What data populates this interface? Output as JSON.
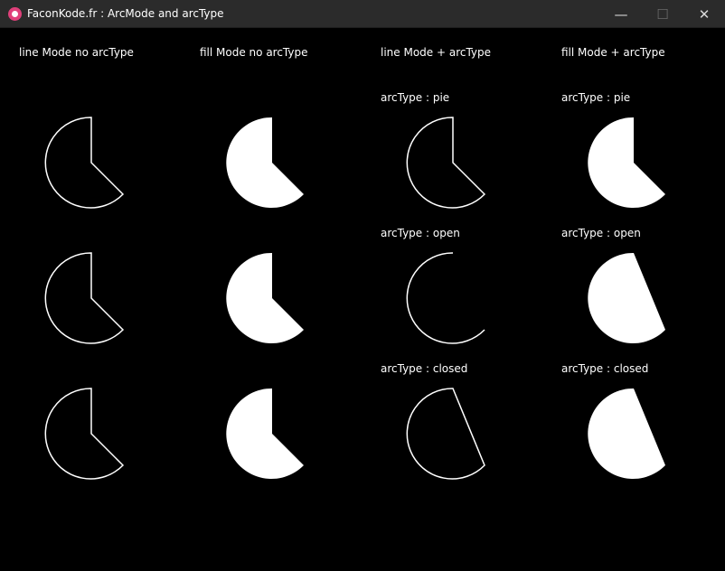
{
  "window": {
    "title": "FaconKode.fr : ArcMode and arcType",
    "minimize_glyph": "—",
    "maximize_glyph": "☐",
    "close_glyph": "✕"
  },
  "columns": {
    "col1": "line Mode no arcType",
    "col2": "fill Mode no arcType",
    "col3": "line Mode + arcType",
    "col4": "fill Mode + arcType"
  },
  "arc_types": {
    "pie": "arcType : pie",
    "open": "arcType : open",
    "closed": "arcType : closed"
  },
  "colors": {
    "background": "#000000",
    "shape": "#ffffff",
    "titlebar": "#2b2b2b"
  }
}
